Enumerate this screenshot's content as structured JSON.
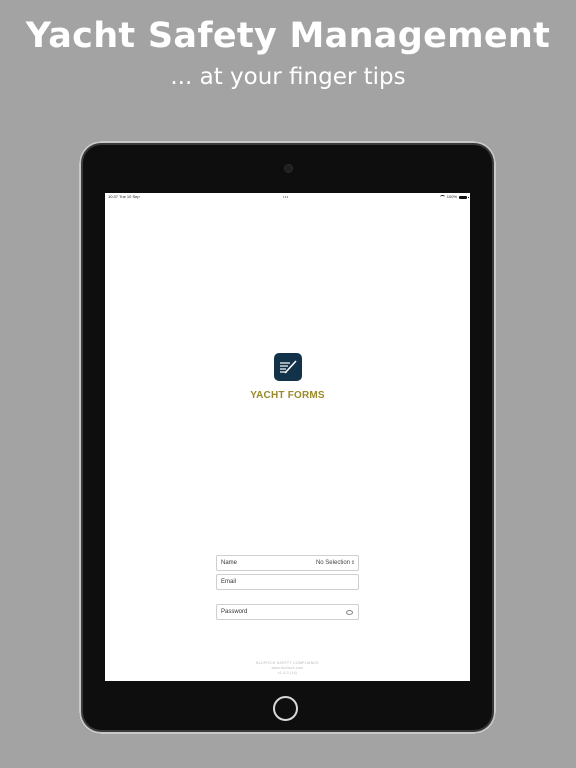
{
  "promo": {
    "headline": "Yacht Safety Management",
    "subline": "... at your finger tips"
  },
  "status_bar": {
    "time": "10:37  Tue 10 Sep",
    "center": "•••",
    "battery": "100%"
  },
  "app": {
    "brand": "YACHT FORMS",
    "logo_icon": "pen-on-lines-icon",
    "accent_color": "#9a8a28",
    "logo_color": "#12324a"
  },
  "login": {
    "name_label": "Name",
    "name_value": "No Selection",
    "email_placeholder": "Email",
    "password_placeholder": "Password"
  },
  "footer": {
    "line1": "BLUFISCH SAFETY COMPLIANCE",
    "line2": "www.blufisch.com",
    "line3": "v1.0.0 (14)"
  }
}
